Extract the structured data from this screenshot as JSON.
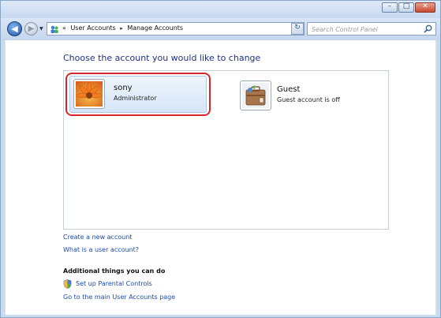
{
  "window": {
    "controls": {
      "minimize_glyph": "–",
      "maximize_glyph": "□",
      "close_glyph": "✕"
    }
  },
  "nav": {
    "back_glyph": "◀",
    "forward_glyph": "▶",
    "dropdown_glyph": "▼"
  },
  "address": {
    "overflow": "«",
    "crumbs": [
      "User Accounts",
      "Manage Accounts"
    ],
    "separator": "▸",
    "dropdown_glyph": "▼",
    "refresh_glyph": "↻"
  },
  "search": {
    "placeholder": "Search Control Panel"
  },
  "main": {
    "title": "Choose the account you would like to change",
    "accounts": [
      {
        "name": "sony",
        "role": "Administrator",
        "selected": true,
        "avatar": "flower-avatar-icon"
      },
      {
        "name": "Guest",
        "role": "Guest account is off",
        "selected": false,
        "avatar": "guest-suitcase-icon"
      }
    ],
    "links": {
      "create": "Create a new account",
      "what": "What is a user account?"
    },
    "additional": {
      "heading": "Additional things you can do",
      "parental": "Set up Parental Controls",
      "main_page": "Go to the main User Accounts page"
    }
  },
  "colors": {
    "selection_outline": "#d6262b",
    "title_text": "#1e3287",
    "link_text": "#1a4bb0"
  }
}
